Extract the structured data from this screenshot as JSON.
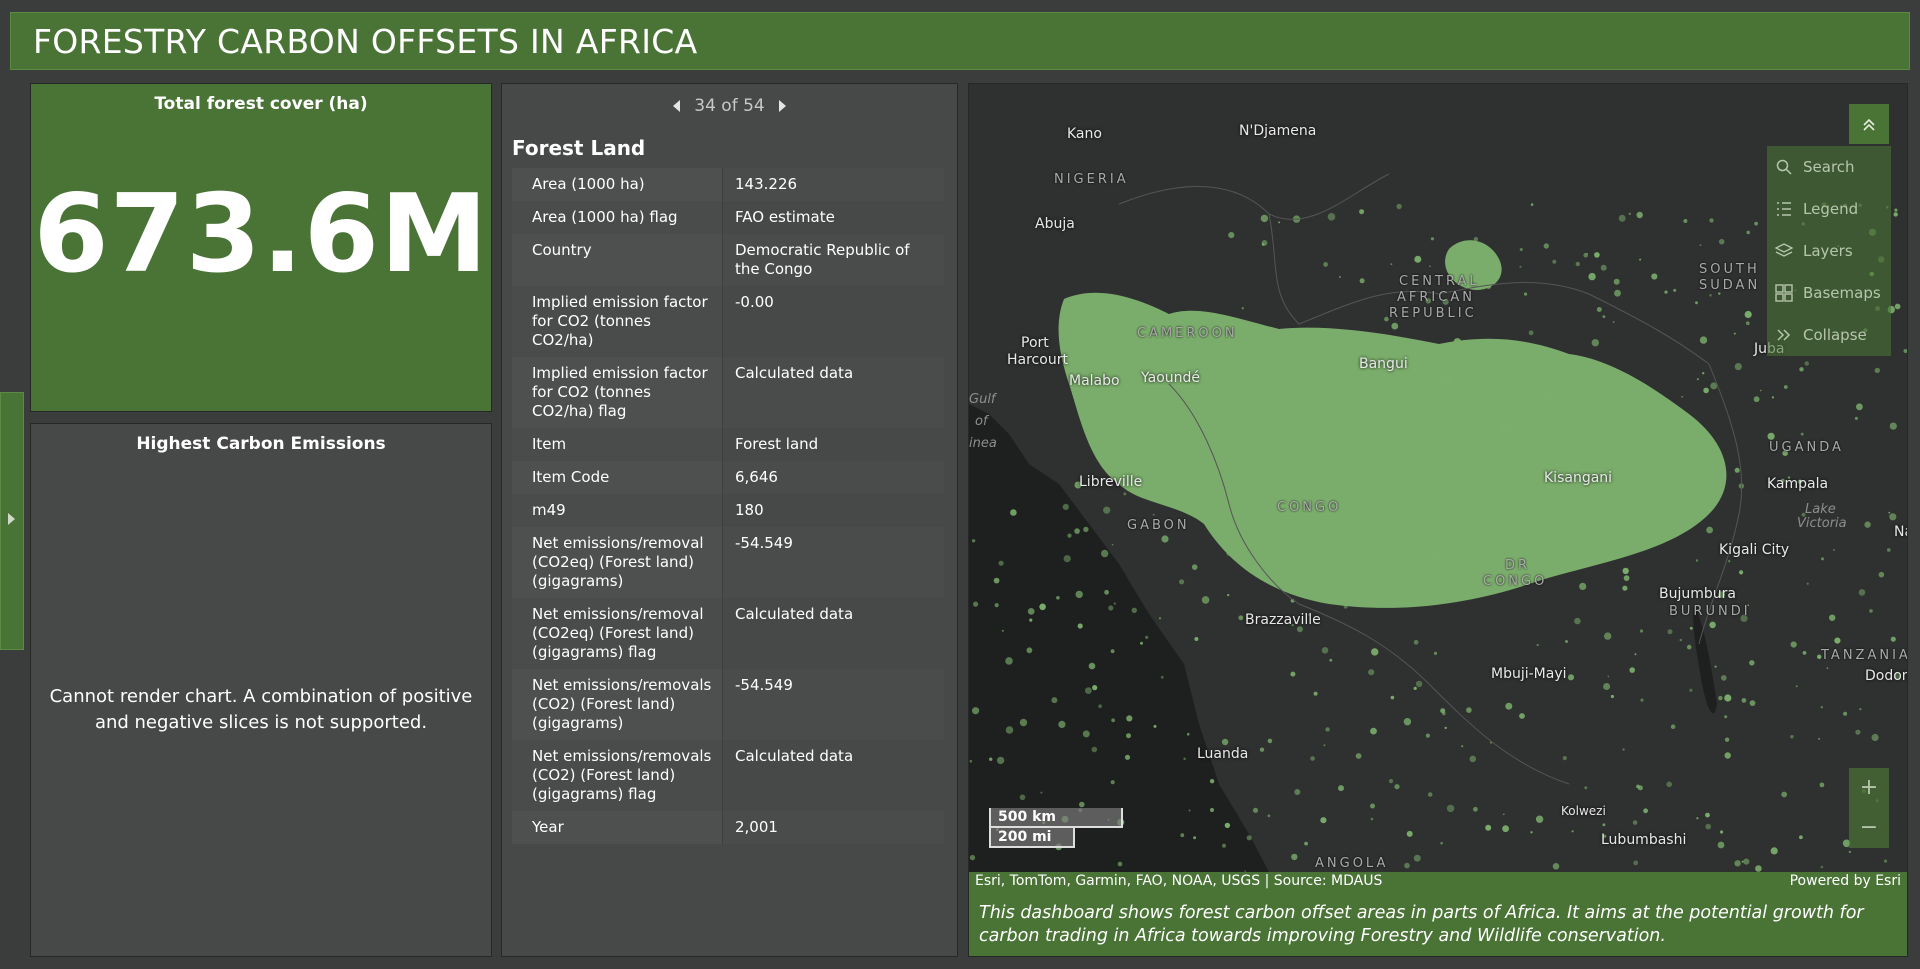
{
  "header": {
    "title": "FORESTRY CARBON OFFSETS IN AFRICA"
  },
  "kpi": {
    "title": "Total forest cover (ha)",
    "value": "673.6M"
  },
  "chart_panel": {
    "title": "Highest Carbon Emissions",
    "message": "Cannot render chart. A combination of positive and negative slices is not supported."
  },
  "details": {
    "pager": "34 of 54",
    "title": "Forest Land",
    "rows": [
      {
        "k": "Area (1000 ha)",
        "v": "143.226"
      },
      {
        "k": "Area (1000 ha) flag",
        "v": "FAO estimate"
      },
      {
        "k": "Country",
        "v": "Democratic Republic of the Congo"
      },
      {
        "k": "Implied emission factor for CO2 (tonnes CO2/ha)",
        "v": "-0.00"
      },
      {
        "k": "Implied emission factor for CO2 (tonnes CO2/ha) flag",
        "v": "Calculated data"
      },
      {
        "k": "Item",
        "v": "Forest land"
      },
      {
        "k": "Item Code",
        "v": "6,646"
      },
      {
        "k": "m49",
        "v": "180"
      },
      {
        "k": "Net emissions/removal (CO2eq) (Forest land) (gigagrams)",
        "v": "-54.549"
      },
      {
        "k": "Net emissions/removal (CO2eq) (Forest land) (gigagrams) flag",
        "v": "Calculated data"
      },
      {
        "k": "Net emissions/removals (CO2) (Forest land) (gigagrams)",
        "v": "-54.549"
      },
      {
        "k": "Net emissions/removals (CO2) (Forest land) (gigagrams) flag",
        "v": "Calculated data"
      },
      {
        "k": "Year",
        "v": "2,001"
      }
    ]
  },
  "map": {
    "labels": {
      "kano": "Kano",
      "ndjamena": "N'Djamena",
      "nigeria": "NIGERIA",
      "abuja": "Abuja",
      "car1": "CENTRAL",
      "car2": "AFRICAN",
      "car3": "REPUBLIC",
      "ssudan1": "SOUTH",
      "ssudan2": "SUDAN",
      "juba": "Juba",
      "porth1": "Port",
      "porth2": "Harcourt",
      "cameroon": "CAMEROON",
      "malabo": "Malabo",
      "yaounde": "Yaoundé",
      "bangui": "Bangui",
      "gulf1": "Gulf",
      "gulf2": "of",
      "gulf3": "inea",
      "uganda": "UGANDA",
      "kampala": "Kampala",
      "lake1": "Lake",
      "lake2": "Victoria",
      "na": "Na",
      "libreville": "Libreville",
      "kisangani": "Kisangani",
      "congo": "CONGO",
      "gabon": "GABON",
      "kigali": "Kigali City",
      "drc1": "DR",
      "drc2": "CONGO",
      "bujumbura": "Bujumbura",
      "burundi": "BURUNDI",
      "brazzaville": "Brazzaville",
      "tanzania": "TANZANIA",
      "dodoma": "Dodom",
      "mbujimayi": "Mbuji-Mayi",
      "luanda": "Luanda",
      "kolwezi": "Kolwezi",
      "lubumbashi": "Lubumbashi",
      "angola": "ANGOLA"
    },
    "menu": {
      "search": "Search",
      "legend": "Legend",
      "layers": "Layers",
      "basemaps": "Basemaps",
      "collapse": "Collapse"
    },
    "zoom_in": "+",
    "zoom_out": "−",
    "scale_km": "500 km",
    "scale_mi": "200 mi",
    "attribution": "Esri, TomTom, Garmin, FAO, NOAA, USGS | Source: MDAUS",
    "powered": "Powered by Esri",
    "description": "This dashboard shows forest carbon offset areas in parts of Africa. It aims at the potential growth for carbon trading in Africa towards improving Forestry and Wildlife conservation.",
    "colors": {
      "forest": "#7aad6b",
      "land": "#2f3030",
      "water": "#1e1f1f",
      "accent": "#4a7336"
    }
  }
}
